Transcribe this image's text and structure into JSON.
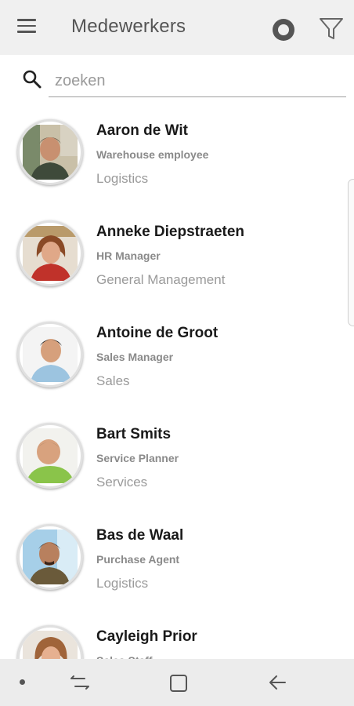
{
  "app": {
    "title": "Medewerkers"
  },
  "search": {
    "placeholder": "zoeken",
    "value": ""
  },
  "employees": [
    {
      "name": "Aaron de Wit",
      "role": "Warehouse employee",
      "department": "Logistics"
    },
    {
      "name": "Anneke Diepstraeten",
      "role": "HR Manager",
      "department": "General Management"
    },
    {
      "name": "Antoine de Groot",
      "role": "Sales Manager",
      "department": "Sales"
    },
    {
      "name": "Bart Smits",
      "role": "Service Planner",
      "department": "Services"
    },
    {
      "name": "Bas de Waal",
      "role": "Purchase Agent",
      "department": "Logistics"
    },
    {
      "name": "Cayleigh Prior",
      "role": "Sales Staff",
      "department": ""
    }
  ],
  "icons": {
    "menu": "menu-icon",
    "record": "record-icon",
    "filter": "filter-icon",
    "search": "search-icon",
    "recent": "recent-apps-icon",
    "home": "home-icon",
    "back": "back-icon"
  },
  "colors": {
    "appbar": "#f0f0f0",
    "navbar": "#ececec",
    "title": "#555555",
    "secondary_text": "#9a9a9a"
  }
}
